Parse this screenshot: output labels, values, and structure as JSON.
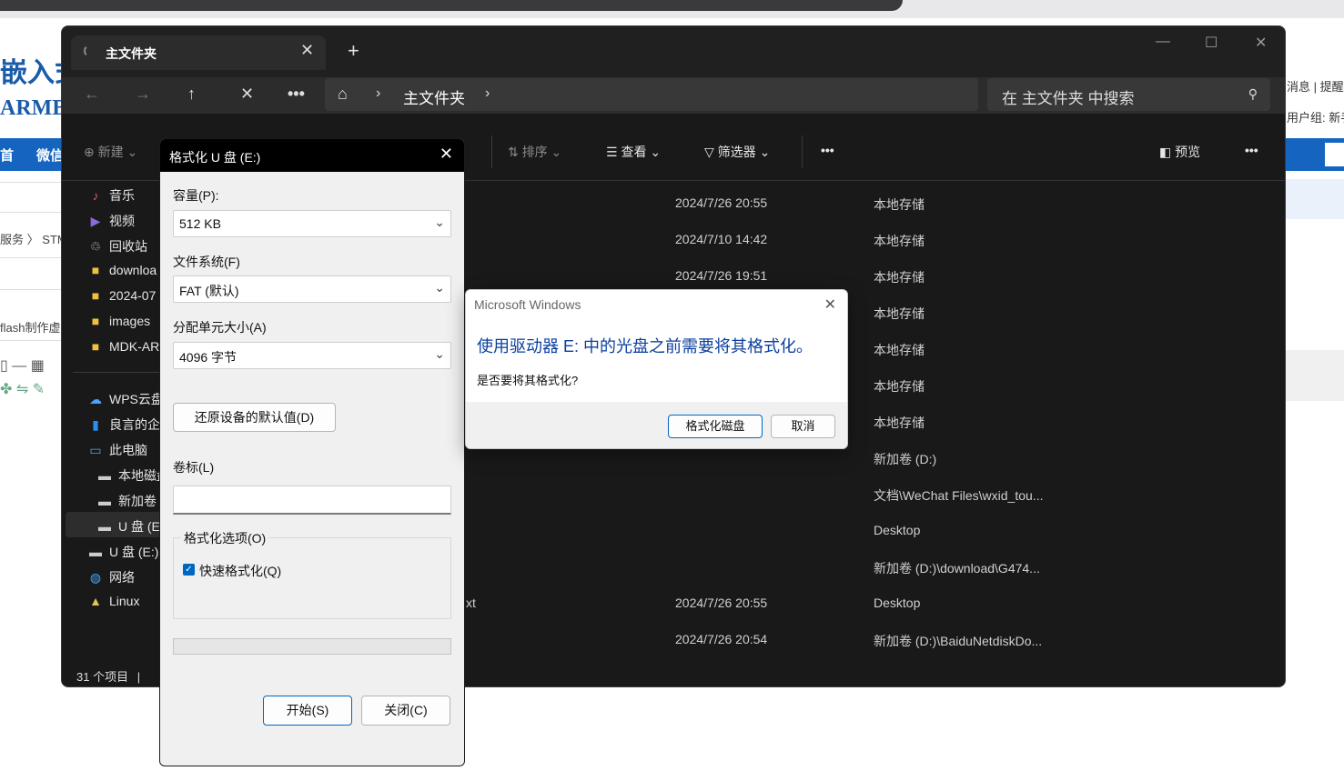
{
  "background": {
    "logo_line1": "嵌入式",
    "logo_line2": "ARMBBS",
    "nav_items": [
      "首",
      "微信"
    ],
    "right_links": [
      "消息",
      "|",
      "提醒"
    ],
    "user_group": "用户组: 新手",
    "breadcrumb_1": "服务",
    "breadcrumb_sep": "〉",
    "breadcrumb_2": "STM",
    "thread_title": "flash制作虚拟"
  },
  "explorer": {
    "tab_title": "主文件夹",
    "address": "主文件夹",
    "search_placeholder": "在 主文件夹 中搜索",
    "toolbar": {
      "new": "新建",
      "sort": "排序",
      "view": "查看",
      "filter": "筛选器",
      "preview": "预览"
    },
    "sidebar": [
      {
        "label": "音乐",
        "icon": "music-icon"
      },
      {
        "label": "视频",
        "icon": "video-icon"
      },
      {
        "label": "回收站",
        "icon": "recycle-bin-icon"
      },
      {
        "label": "downloa",
        "icon": "folder-icon"
      },
      {
        "label": "2024-07",
        "icon": "folder-icon"
      },
      {
        "label": "images",
        "icon": "folder-icon"
      },
      {
        "label": "MDK-AR",
        "icon": "folder-icon"
      },
      {
        "label": "WPS云盘",
        "icon": "cloud-icon"
      },
      {
        "label": "良言的企",
        "icon": "onedrive-icon"
      },
      {
        "label": "此电脑",
        "icon": "pc-icon"
      },
      {
        "label": "本地磁盘",
        "icon": "drive-icon"
      },
      {
        "label": "新加卷",
        "icon": "drive-icon"
      },
      {
        "label": "U 盘 (E",
        "icon": "usb-drive-icon"
      },
      {
        "label": "U 盘 (E:)",
        "icon": "usb-drive-icon"
      },
      {
        "label": "网络",
        "icon": "network-icon"
      },
      {
        "label": "Linux",
        "icon": "linux-icon"
      }
    ],
    "rows": [
      {
        "name": "",
        "date": "2024/7/26 20:55",
        "location": "本地存储"
      },
      {
        "name": "",
        "date": "2024/7/10 14:42",
        "location": "本地存储"
      },
      {
        "name": "",
        "date": "2024/7/26 19:51",
        "location": "本地存储"
      },
      {
        "name": "",
        "date": "",
        "location": "本地存储"
      },
      {
        "name": "",
        "date": "",
        "location": "本地存储"
      },
      {
        "name": "",
        "date": "",
        "location": "本地存储"
      },
      {
        "name": "",
        "date": "",
        "location": "本地存储"
      },
      {
        "name": "",
        "date": "",
        "location": "新加卷 (D:)"
      },
      {
        "name": "",
        "date": "",
        "location": "文档\\WeChat Files\\wxid_tou..."
      },
      {
        "name": "",
        "date": "",
        "location": "Desktop"
      },
      {
        "name": "",
        "date": "",
        "location": "新加卷 (D:)\\download\\G474..."
      },
      {
        "name": "xt",
        "date": "2024/7/26 20:55",
        "location": "Desktop"
      },
      {
        "name": "",
        "date": "2024/7/26 20:54",
        "location": "新加卷 (D:)\\BaiduNetdiskDo..."
      }
    ],
    "status": "31 个项目",
    "status_sep": "|"
  },
  "format_dialog": {
    "title": "格式化 U 盘 (E:)",
    "capacity_label": "容量(P):",
    "capacity_value": "512 KB",
    "fs_label": "文件系统(F)",
    "fs_value": "FAT (默认)",
    "alloc_label": "分配单元大小(A)",
    "alloc_value": "4096 字节",
    "restore_button": "还原设备的默认值(D)",
    "volume_label": "卷标(L)",
    "volume_value": "",
    "options_label": "格式化选项(O)",
    "quick_format": "快速格式化(Q)",
    "quick_format_checked": true,
    "progress": 0,
    "start_button": "开始(S)",
    "close_button": "关闭(C)"
  },
  "message_dialog": {
    "title": "Microsoft Windows",
    "heading": "使用驱动器 E: 中的光盘之前需要将其格式化。",
    "body": "是否要将其格式化?",
    "format_button": "格式化磁盘",
    "cancel_button": "取消"
  },
  "colors": {
    "explorer_bg": "#191919",
    "accent": "#0067c0",
    "brand_blue": "#1565c0",
    "heading_blue": "#0a3fa0"
  }
}
